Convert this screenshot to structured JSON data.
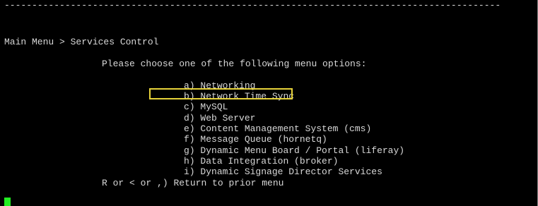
{
  "terminal": {
    "separator": "------------------------------------------------------------------------------------------",
    "breadcrumb": "Main Menu > Services Control",
    "prompt": "Please choose one of the following menu options:",
    "options": [
      {
        "key": "a)",
        "label": "Networking"
      },
      {
        "key": "b)",
        "label": "Network Time Sync"
      },
      {
        "key": "c)",
        "label": "MySQL"
      },
      {
        "key": "d)",
        "label": "Web Server"
      },
      {
        "key": "e)",
        "label": "Content Management System (cms)"
      },
      {
        "key": "f)",
        "label": "Message Queue (hornetq)"
      },
      {
        "key": "g)",
        "label": "Dynamic Menu Board / Portal (liferay)"
      },
      {
        "key": "h)",
        "label": "Data Integration (broker)"
      },
      {
        "key": "i)",
        "label": "Dynamic Signage Director Services"
      },
      {
        "key": "R or < or ,)",
        "label": "Return to prior menu"
      }
    ],
    "highlighted_option": "b)",
    "colors": {
      "background": "#000000",
      "text": "#d8d8d8",
      "highlight_border": "#e6d23a",
      "cursor": "#22ee22"
    }
  }
}
